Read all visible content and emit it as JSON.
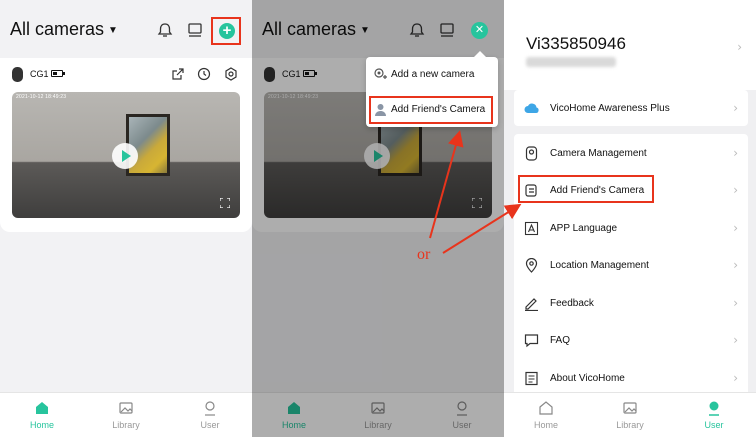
{
  "home": {
    "title": "All cameras",
    "camera_name": "CG1",
    "video_timestamp": "2021-10-12 18:49:23"
  },
  "tabs": [
    {
      "label": "Home"
    },
    {
      "label": "Library"
    },
    {
      "label": "User"
    }
  ],
  "add_menu": {
    "items": [
      {
        "label": "Add a new camera",
        "icon": "camera-plus-icon"
      },
      {
        "label": "Add Friend's Camera",
        "icon": "person-icon"
      }
    ]
  },
  "annotation": {
    "or_text": "or",
    "highlight_color": "#e8341c"
  },
  "user_page": {
    "username": "Vi335850946",
    "plus_label": "VicoHome Awareness Plus",
    "menu": [
      {
        "label": "Camera Management",
        "icon": "camera-icon"
      },
      {
        "label": "Add Friend's Camera",
        "icon": "share-camera-icon"
      },
      {
        "label": "APP Language",
        "icon": "language-icon"
      },
      {
        "label": "Location Management",
        "icon": "location-pin-icon"
      },
      {
        "label": "Feedback",
        "icon": "pencil-icon"
      },
      {
        "label": "FAQ",
        "icon": "chat-bubble-icon"
      },
      {
        "label": "About VicoHome",
        "icon": "document-icon"
      }
    ]
  },
  "colors": {
    "accent": "#27c49d",
    "annotation_red": "#e8341c"
  }
}
